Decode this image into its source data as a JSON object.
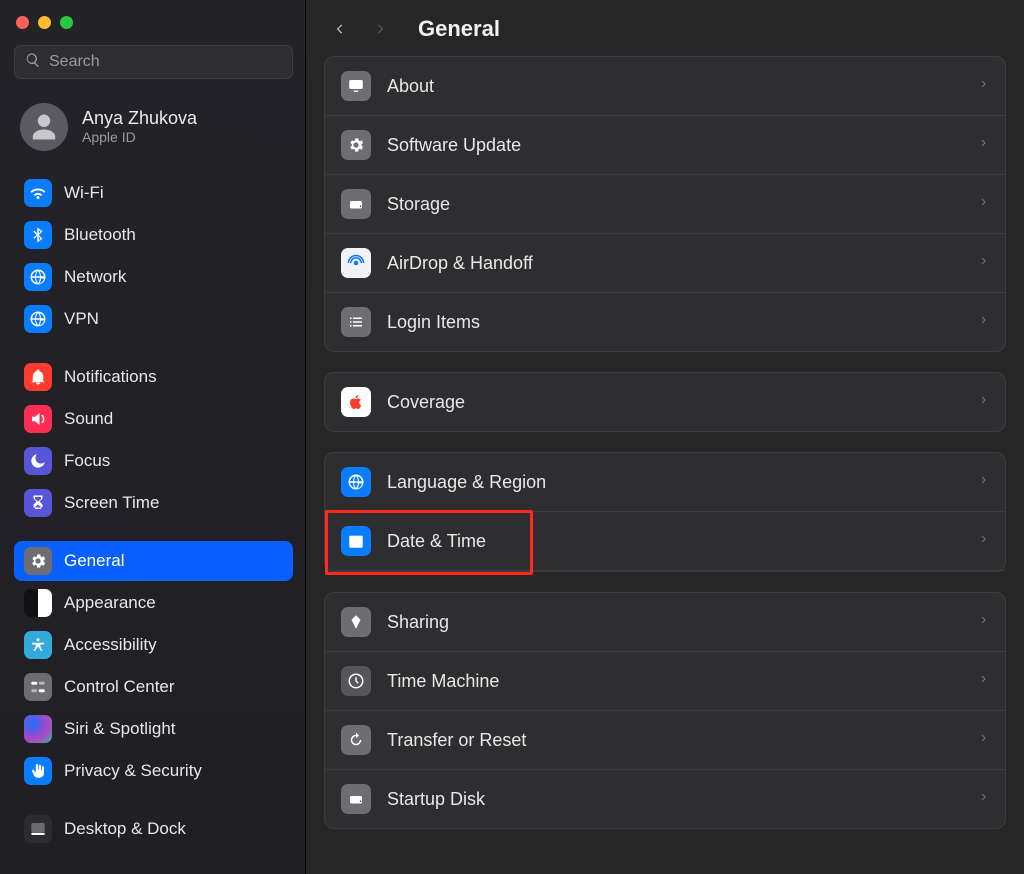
{
  "search_placeholder": "Search",
  "account": {
    "name": "Anya Zhukova",
    "subtitle": "Apple ID"
  },
  "sidebar": [
    {
      "key": "wifi",
      "label": "Wi-Fi"
    },
    {
      "key": "bluetooth",
      "label": "Bluetooth"
    },
    {
      "key": "network",
      "label": "Network"
    },
    {
      "key": "vpn",
      "label": "VPN"
    },
    {
      "key": "notifications",
      "label": "Notifications"
    },
    {
      "key": "sound",
      "label": "Sound"
    },
    {
      "key": "focus",
      "label": "Focus"
    },
    {
      "key": "screentime",
      "label": "Screen Time"
    },
    {
      "key": "general",
      "label": "General"
    },
    {
      "key": "appearance",
      "label": "Appearance"
    },
    {
      "key": "accessibility",
      "label": "Accessibility"
    },
    {
      "key": "controlcenter",
      "label": "Control Center"
    },
    {
      "key": "siri",
      "label": "Siri & Spotlight"
    },
    {
      "key": "privacy",
      "label": "Privacy & Security"
    },
    {
      "key": "desktop",
      "label": "Desktop & Dock"
    }
  ],
  "title": "General",
  "groups": [
    [
      {
        "key": "about",
        "label": "About"
      },
      {
        "key": "software",
        "label": "Software Update"
      },
      {
        "key": "storage",
        "label": "Storage"
      },
      {
        "key": "airdrop",
        "label": "AirDrop & Handoff"
      },
      {
        "key": "login",
        "label": "Login Items"
      }
    ],
    [
      {
        "key": "coverage",
        "label": "Coverage"
      }
    ],
    [
      {
        "key": "language",
        "label": "Language & Region"
      },
      {
        "key": "datetime",
        "label": "Date & Time",
        "highlighted": true
      }
    ],
    [
      {
        "key": "sharing",
        "label": "Sharing"
      },
      {
        "key": "timemachine",
        "label": "Time Machine"
      },
      {
        "key": "transfer",
        "label": "Transfer or Reset"
      },
      {
        "key": "startup",
        "label": "Startup Disk"
      }
    ]
  ]
}
